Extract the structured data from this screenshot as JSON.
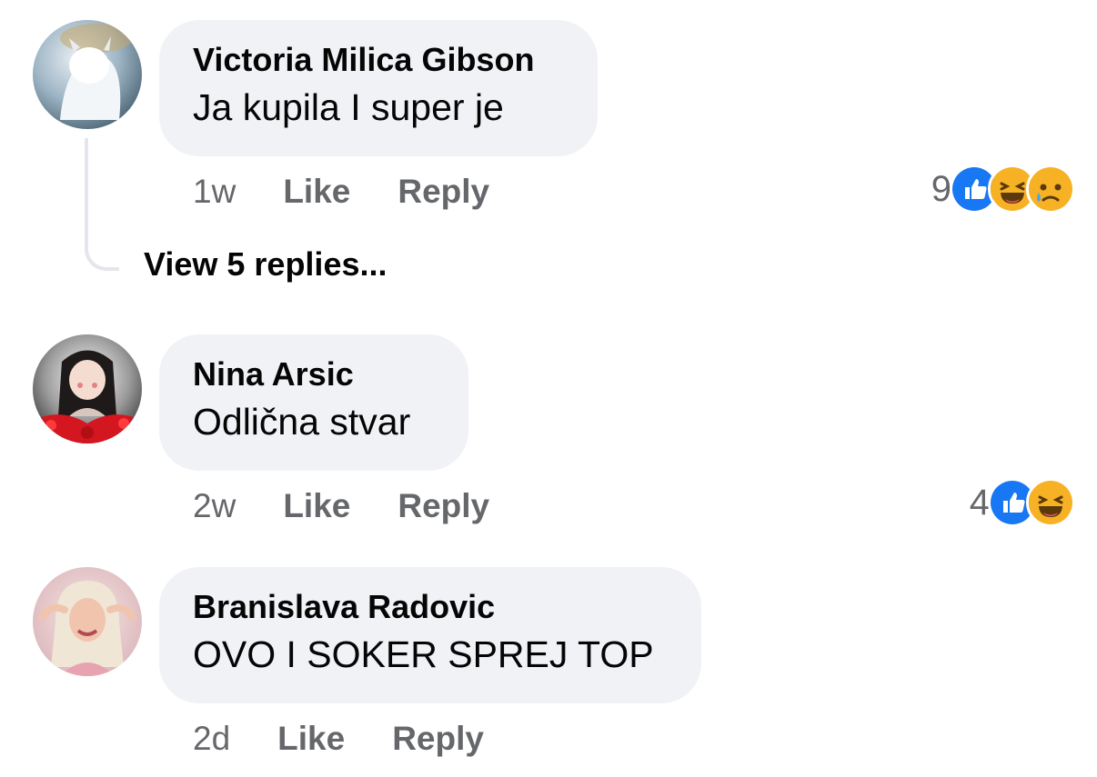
{
  "comments": [
    {
      "author": "Victoria Milica Gibson",
      "text": "Ja kupila I super je",
      "time": "1w",
      "like_label": "Like",
      "reply_label": "Reply",
      "reaction_count": "9",
      "reactions": [
        "like-icon",
        "haha-icon",
        "sad-icon"
      ],
      "view_replies": "View 5 replies..."
    },
    {
      "author": "Nina Arsic",
      "text": "Odlična stvar",
      "time": "2w",
      "like_label": "Like",
      "reply_label": "Reply",
      "reaction_count": "4",
      "reactions": [
        "like-icon",
        "haha-icon"
      ]
    },
    {
      "author": "Branislava Radovic",
      "text": "OVO I SOKER SPREJ TOP",
      "time": "2d",
      "like_label": "Like",
      "reply_label": "Reply"
    }
  ],
  "colors": {
    "bubble": "#f0f2f5",
    "meta_text": "#65676b",
    "like_blue": "#1877f2",
    "emoji_yellow": "#f7b125"
  }
}
